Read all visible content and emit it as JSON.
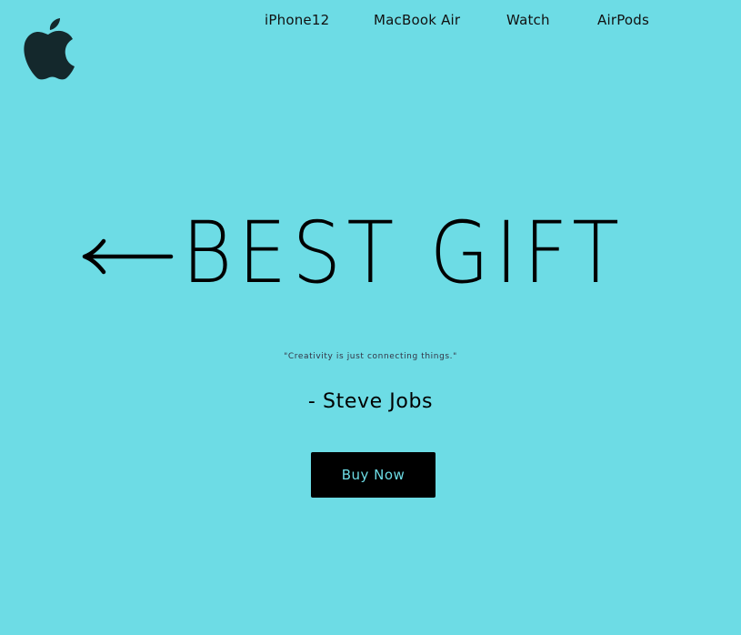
{
  "brand": {
    "logo_icon": "apple-logo-icon",
    "logo_color": "#14282c"
  },
  "nav": {
    "items": [
      {
        "label": "iPhone12"
      },
      {
        "label": "MacBook Air"
      },
      {
        "label": "Watch"
      },
      {
        "label": "AirPods"
      }
    ]
  },
  "hero": {
    "arrow_icon": "left-arrow-icon",
    "title": "BEST GIFT"
  },
  "quote": {
    "text": "\"Creativity is just connecting things.\"",
    "author": "- Steve Jobs"
  },
  "cta": {
    "label": "Buy Now"
  },
  "colors": {
    "background": "#6ddce5",
    "button_bg": "#000000",
    "button_text": "#6ddce5"
  }
}
